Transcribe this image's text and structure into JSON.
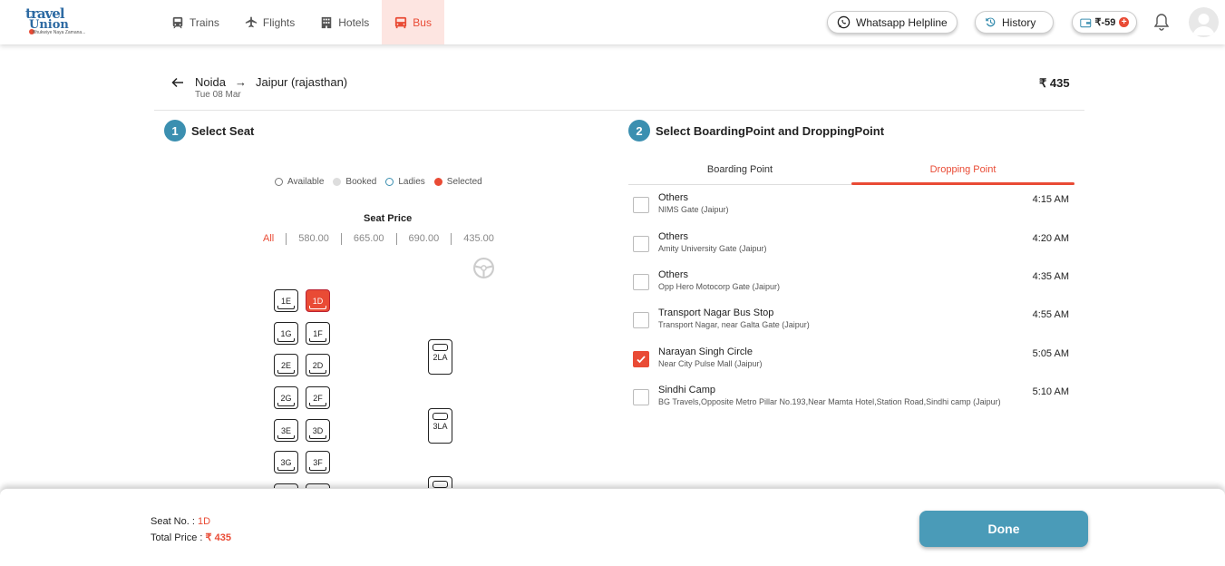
{
  "brand": {
    "line1_a": "t",
    "line1_b": "ravel",
    "line2": "Union",
    "tagline": "Bhukwiye Naya Zamana..."
  },
  "nav": [
    {
      "label": "Trains",
      "icon": "train-icon"
    },
    {
      "label": "Flights",
      "icon": "plane-icon"
    },
    {
      "label": "Hotels",
      "icon": "hotel-icon"
    },
    {
      "label": "Bus",
      "icon": "bus-icon",
      "active": true
    }
  ],
  "header": {
    "whatsapp_label": "Whatsapp Helpline",
    "history_label": "History",
    "wallet_label": "₹-59"
  },
  "trip": {
    "from": "Noida",
    "arrow": "→",
    "to": "Jaipur (rajasthan)",
    "date": "Tue 08 Mar",
    "fare": "₹ 435"
  },
  "steps": {
    "step1": {
      "num": "1",
      "label": "Select Seat"
    },
    "step2": {
      "num": "2",
      "label": "Select BoardingPoint and DroppingPoint"
    }
  },
  "legend": [
    {
      "label": "Available",
      "color": "#ffffff"
    },
    {
      "label": "Booked",
      "color": "#dddddd"
    },
    {
      "label": "Ladies",
      "color": "#3b8fb0"
    },
    {
      "label": "Selected",
      "color": "#e94b35"
    }
  ],
  "seat_price": {
    "title": "Seat Price",
    "filters": [
      "All",
      "580.00",
      "665.00",
      "690.00",
      "435.00"
    ]
  },
  "seats": {
    "s1E": "1E",
    "s1D": "1D",
    "s1G": "1G",
    "s1F": "1F",
    "s2E": "2E",
    "s2D": "2D",
    "s2G": "2G",
    "s2F": "2F",
    "s3E": "3E",
    "s3D": "3D",
    "s3G": "3G",
    "s3F": "3F",
    "l2LA": "2LA",
    "l3LA": "3LA"
  },
  "tabs": {
    "boarding": "Boarding Point",
    "dropping": "Dropping Point"
  },
  "dropping_points": [
    {
      "name": "Others",
      "address": "NIMS Gate (Jaipur)",
      "time": "4:15 AM",
      "checked": false
    },
    {
      "name": "Others",
      "address": "Amity University Gate (Jaipur)",
      "time": "4:20 AM",
      "checked": false
    },
    {
      "name": "Others",
      "address": "Opp Hero Motocorp Gate (Jaipur)",
      "time": "4:35 AM",
      "checked": false
    },
    {
      "name": "Transport Nagar Bus Stop",
      "address": "Transport Nagar, near Galta Gate (Jaipur)",
      "time": "4:55 AM",
      "checked": false
    },
    {
      "name": "Narayan Singh Circle",
      "address": "Near City Pulse Mall (Jaipur)",
      "time": "5:05 AM",
      "checked": true
    },
    {
      "name": "Sindhi Camp",
      "address": "BG Travels,Opposite Metro Pillar No.193,Near Mamta Hotel,Station Road,Sindhi camp (Jaipur)",
      "time": "5:10 AM",
      "checked": false
    }
  ],
  "summary": {
    "seat_label": "Seat No. :",
    "seat_value": "1D",
    "total_label": "Total Price :",
    "total_value": "₹ 435",
    "done_label": "Done"
  }
}
